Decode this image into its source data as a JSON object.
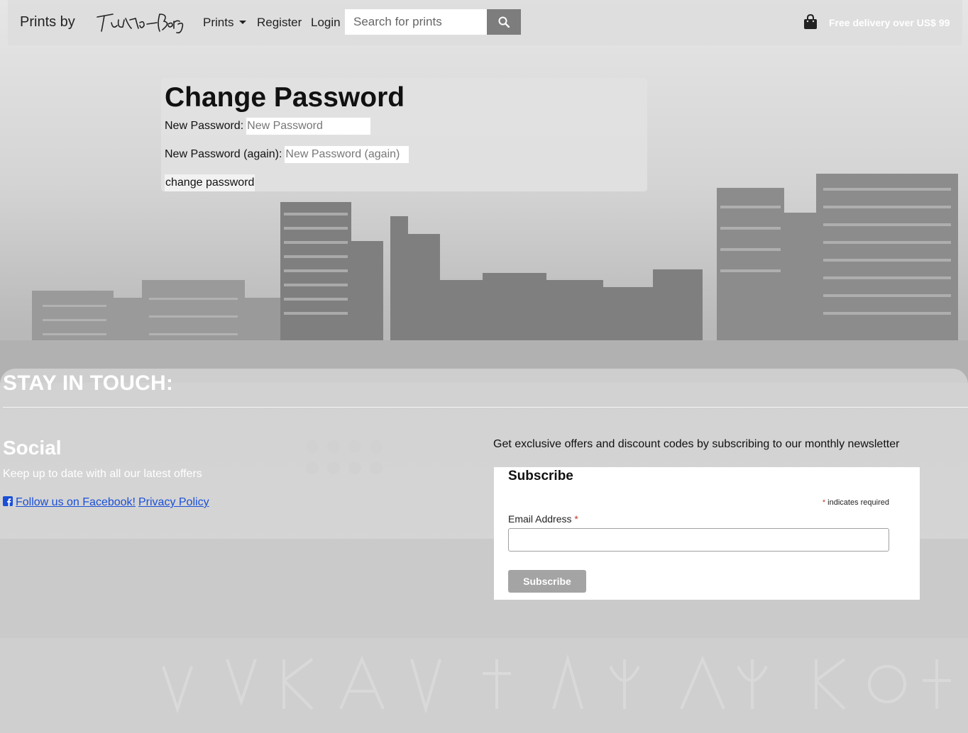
{
  "navbar": {
    "brand_text": "Prints by",
    "brand_logo": "Futuro Berg",
    "nav_prints": "Prints",
    "nav_register": "Register",
    "nav_login": "Login",
    "search_placeholder": "Search for prints",
    "search_icon": "search-icon",
    "bag_icon": "shopping-bag-icon",
    "free_delivery": "Free delivery over US$ 99"
  },
  "change_password": {
    "title": "Change Password",
    "new_password_label": "New Password:",
    "new_password_placeholder": "New Password",
    "new_password_again_label": "New Password (again):",
    "new_password_again_placeholder": "New Password (again)",
    "submit_label": "change password"
  },
  "footer": {
    "stay_in_touch": "STAY IN TOUCH:",
    "social_title": "Social",
    "social_text": "Keep up to date with all our latest offers",
    "facebook_link": "Follow us on Facebook!",
    "facebook_icon": "facebook-square-icon",
    "privacy_link": "Privacy Policy",
    "newsletter_text": "Get exclusive offers and discount codes by subscribing to our monthly newsletter",
    "subscribe": {
      "title": "Subscribe",
      "required_mark": "*",
      "required_note": "indicates required",
      "email_label": "Email Address",
      "email_value": "",
      "button_label": "Subscribe"
    }
  },
  "colors": {
    "link": "#1a4fd6",
    "search_button": "#7d7d7d",
    "subscribe_button": "#a4a4a4",
    "required": "#c0392b"
  }
}
